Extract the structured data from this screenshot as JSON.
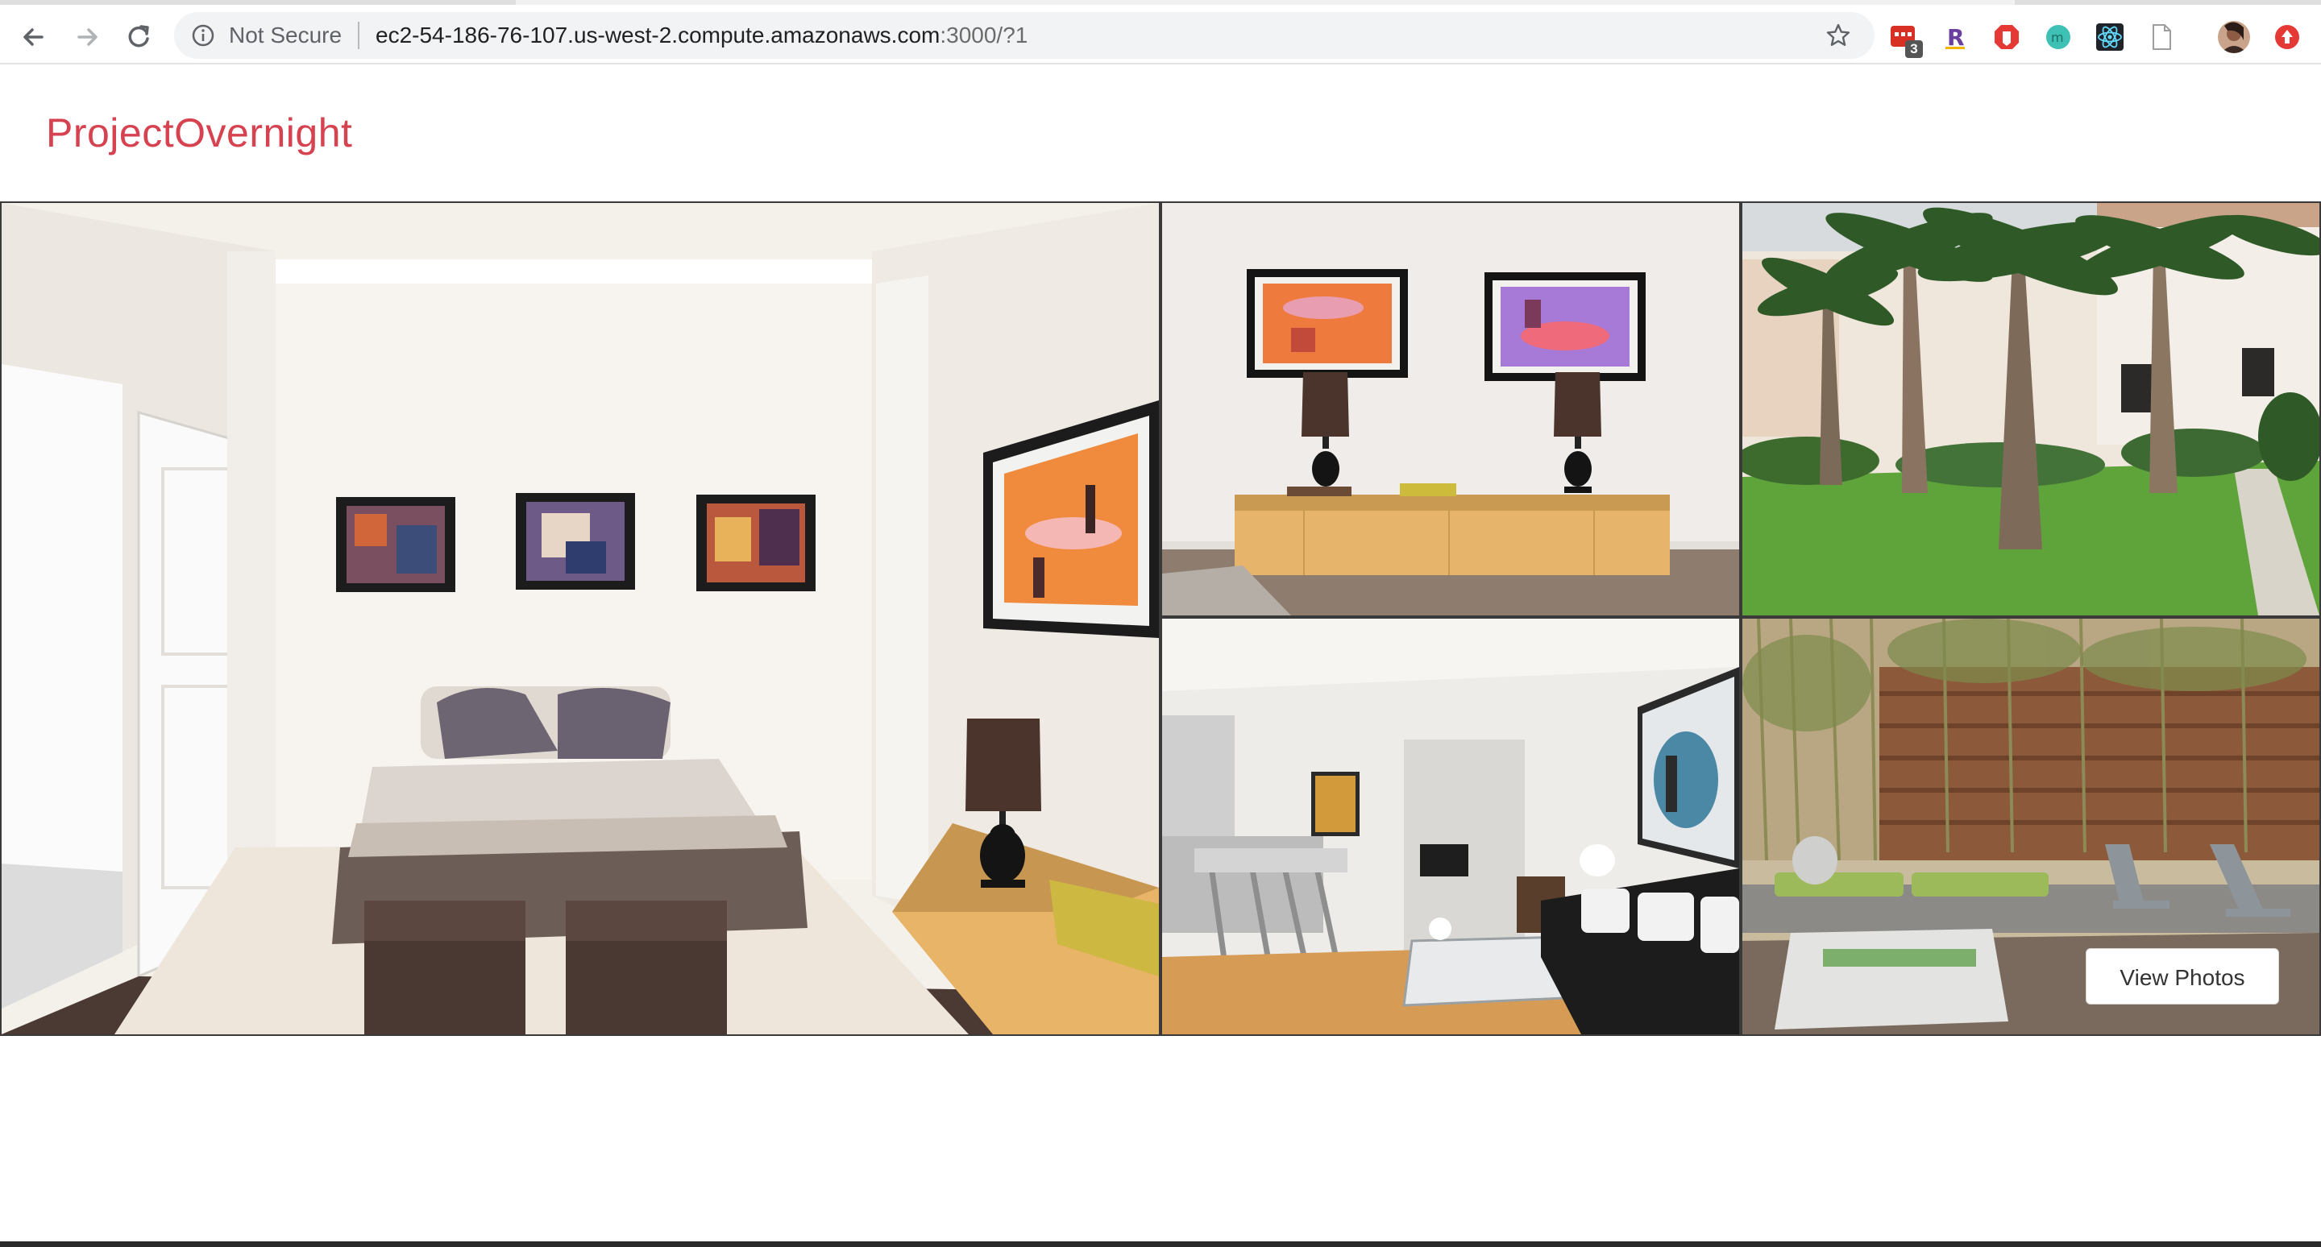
{
  "browser": {
    "security_label": "Not Secure",
    "url_host": "ec2-54-186-76-107.us-west-2.compute.amazonaws.com",
    "url_rest": ":3000/?1",
    "extensions": [
      {
        "name": "todo-extension-icon",
        "badge": "3",
        "color": "#d93025"
      },
      {
        "name": "r-extension-icon",
        "letter": "R",
        "color": "#6a3fa0"
      },
      {
        "name": "shield-extension-icon",
        "color": "#e53935"
      },
      {
        "name": "m-extension-icon",
        "color": "#20b2aa"
      },
      {
        "name": "react-devtools-icon",
        "color": "#61dafb"
      },
      {
        "name": "document-extension-icon",
        "color": "#9e9e9e"
      },
      {
        "name": "profile-avatar",
        "color": "#8d5a44"
      },
      {
        "name": "update-icon",
        "color": "#e53935"
      }
    ]
  },
  "header": {
    "logo": "ProjectOvernight",
    "logo_color": "#d6424f"
  },
  "gallery": {
    "photos": [
      {
        "name": "photo-bedroom",
        "subject": "bedroom"
      },
      {
        "name": "photo-lamps-console",
        "subject": "console with lamps"
      },
      {
        "name": "photo-palm-trees-exterior",
        "subject": "exterior with palm trees"
      },
      {
        "name": "photo-living-room",
        "subject": "living room"
      },
      {
        "name": "photo-patio",
        "subject": "patio with bamboo"
      }
    ],
    "view_photos_label": "View Photos"
  }
}
